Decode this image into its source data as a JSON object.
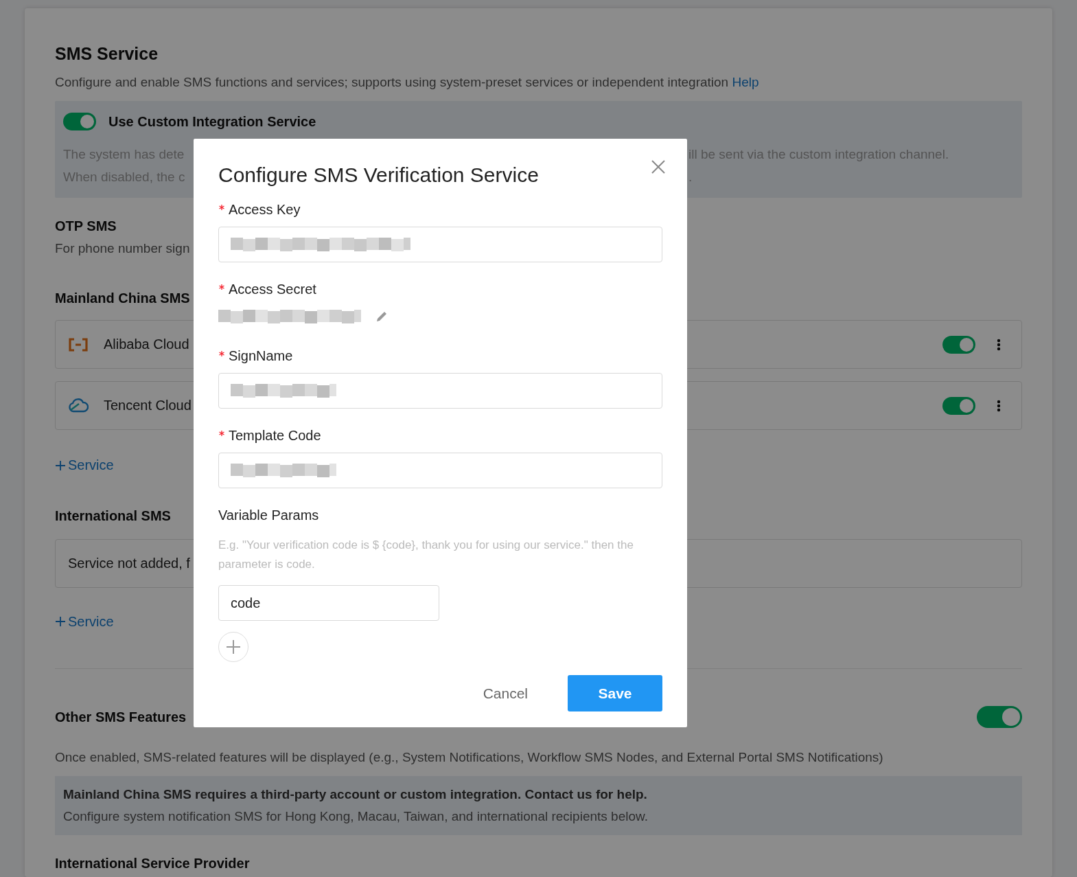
{
  "page": {
    "title": "SMS Service",
    "description": "Configure and enable SMS functions and services; supports using system-preset services or independent integration",
    "help_link": "Help",
    "custom_integration": {
      "label": "Use Custom Integration Service",
      "on": true,
      "lines": [
        {
          "left": "The system has dete",
          "right": "ill be sent via the custom integration channel."
        },
        {
          "left": "When disabled, the c",
          "right": "."
        }
      ]
    },
    "otp": {
      "title": "OTP SMS",
      "description": "For phone number sign"
    },
    "mainland": {
      "title": "Mainland China SMS",
      "services": [
        {
          "name": "Alibaba Cloud",
          "on": true
        },
        {
          "name": "Tencent Cloud",
          "on": true
        }
      ],
      "add_label": "Service"
    },
    "international": {
      "title": "International SMS",
      "empty_text": "Service not added, f",
      "add_label": "Service"
    },
    "other_features": {
      "title": "Other SMS Features",
      "on": true,
      "description": "Once enabled, SMS-related features will be displayed (e.g., System Notifications, Workflow SMS Nodes, and External Portal SMS Notifications)",
      "notice": {
        "heading": "Mainland China SMS requires a third-party account or custom integration. Contact us for help.",
        "text": "Configure system notification SMS for Hong Kong, Macau, Taiwan, and international recipients below."
      },
      "provider_title": "International Service Provider"
    }
  },
  "modal": {
    "title": "Configure SMS Verification Service",
    "fields": [
      {
        "label": "Access Key",
        "required": true,
        "kind": "input"
      },
      {
        "label": "Access Secret",
        "required": true,
        "kind": "secret"
      },
      {
        "label": "SignName",
        "required": true,
        "kind": "input"
      },
      {
        "label": "Template Code",
        "required": true,
        "kind": "input"
      }
    ],
    "variable_params": {
      "label": "Variable Params",
      "hint": "E.g. \"Your verification code is $ {code}, thank you for using our service.\" then the parameter is code.",
      "values": [
        "code"
      ]
    },
    "buttons": {
      "cancel": "Cancel",
      "save": "Save"
    }
  }
}
